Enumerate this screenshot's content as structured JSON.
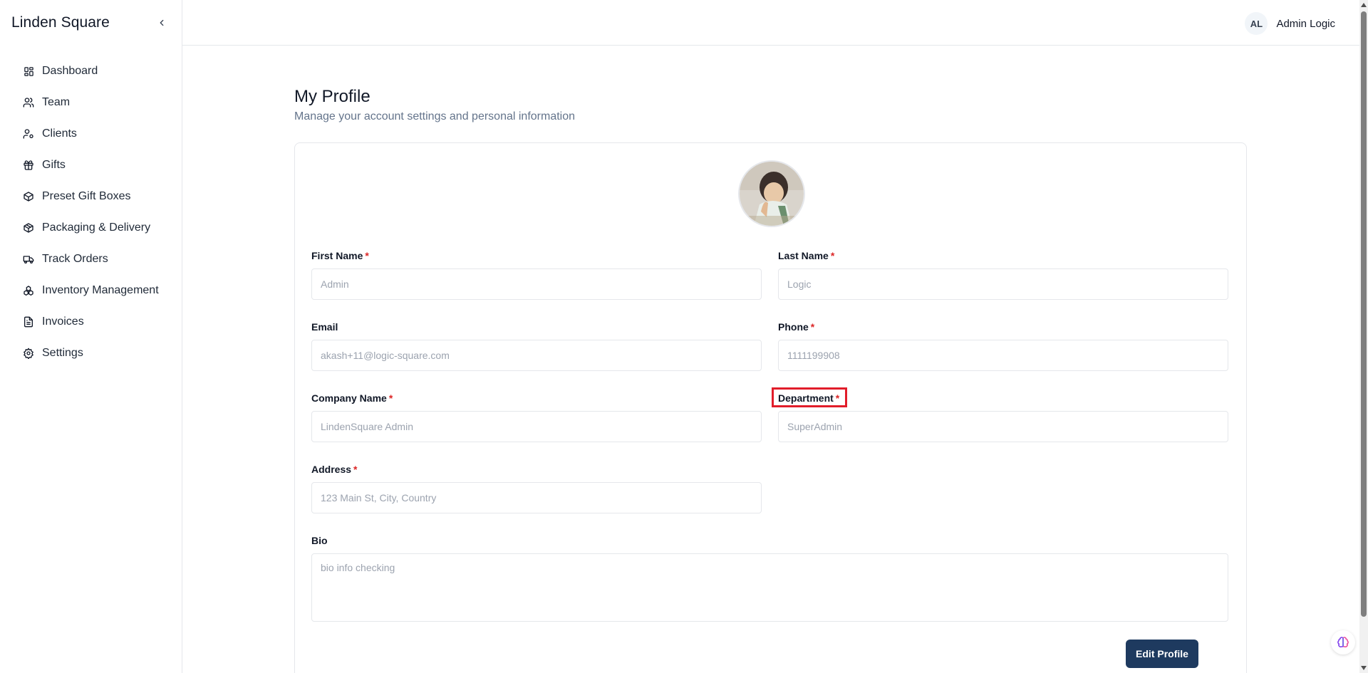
{
  "app": {
    "brand": "Linden Square"
  },
  "sidebar": {
    "items": [
      {
        "label": "Dashboard",
        "icon": "dashboard-icon"
      },
      {
        "label": "Team",
        "icon": "users-icon"
      },
      {
        "label": "Clients",
        "icon": "user-cog-icon"
      },
      {
        "label": "Gifts",
        "icon": "gift-icon"
      },
      {
        "label": "Preset Gift Boxes",
        "icon": "box-icon"
      },
      {
        "label": "Packaging & Delivery",
        "icon": "package-icon"
      },
      {
        "label": "Track Orders",
        "icon": "truck-icon"
      },
      {
        "label": "Inventory Management",
        "icon": "boxes-icon"
      },
      {
        "label": "Invoices",
        "icon": "file-text-icon"
      },
      {
        "label": "Settings",
        "icon": "gear-icon"
      }
    ]
  },
  "header": {
    "user_initials": "AL",
    "user_name": "Admin Logic"
  },
  "page": {
    "title": "My Profile",
    "subtitle": "Manage your account settings and personal information"
  },
  "form": {
    "first_name": {
      "label": "First Name",
      "required": "*",
      "value": "Admin"
    },
    "last_name": {
      "label": "Last Name",
      "required": "*",
      "value": "Logic"
    },
    "email": {
      "label": "Email",
      "value": "akash+11@logic-square.com"
    },
    "phone": {
      "label": "Phone",
      "required": "*",
      "value": "1111199908"
    },
    "company": {
      "label": "Company Name",
      "required": "*",
      "value": "LindenSquare Admin"
    },
    "department": {
      "label": "Department",
      "required": "*",
      "value": "SuperAdmin"
    },
    "address": {
      "label": "Address",
      "required": "*",
      "value": "123 Main St, City, Country"
    },
    "bio": {
      "label": "Bio",
      "value": "bio info checking"
    },
    "edit_button": "Edit Profile"
  },
  "colors": {
    "accent": "#1e3a5f",
    "required": "#dc2626",
    "highlight": "#e11d2a"
  }
}
